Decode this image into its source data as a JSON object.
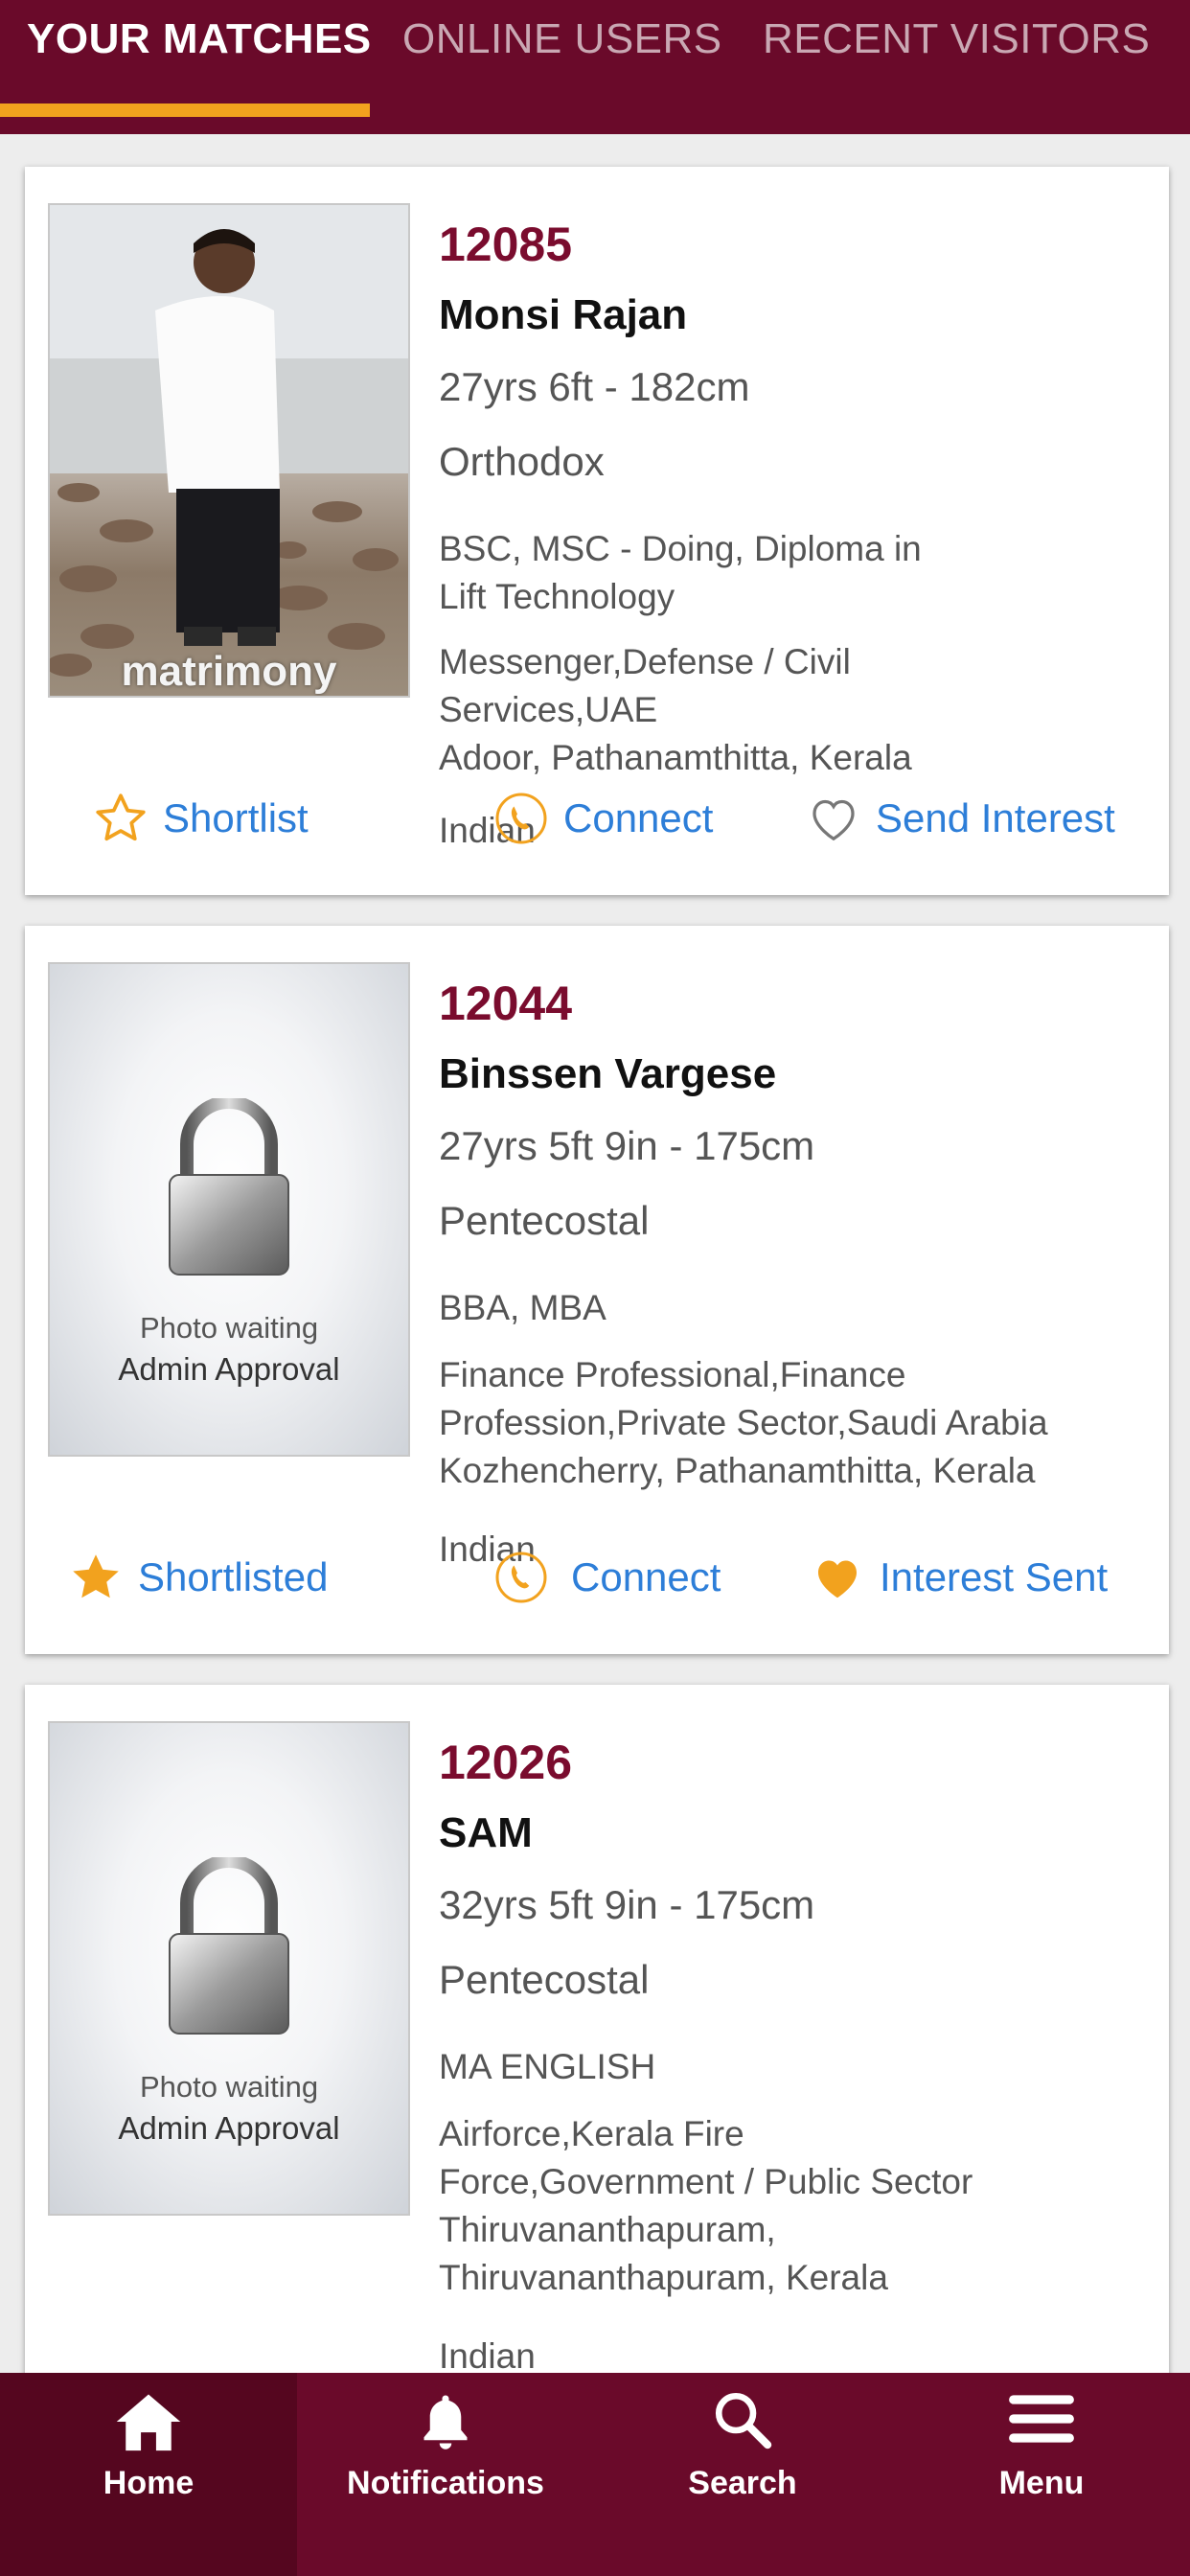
{
  "tabs": [
    {
      "label": "YOUR MATCHES",
      "active": true
    },
    {
      "label": "ONLINE USERS",
      "active": false
    },
    {
      "label": "RECENT VISITORS",
      "active": false
    }
  ],
  "photo_watermark": "matrimony",
  "locked_photo": {
    "line1": "Photo waiting",
    "line2": "Admin Approval"
  },
  "profiles": [
    {
      "id": "12085",
      "name": "Monsi Rajan",
      "age_height": "27yrs 6ft - 182cm",
      "denomination": "Orthodox",
      "education_1": "BSC, MSC - Doing, Diploma in",
      "education_2": "Lift Technology",
      "job_1": "Messenger,Defense / Civil",
      "job_2": "Services,UAE",
      "location": "Adoor, Pathanamthitta, Kerala",
      "nationality": "Indian",
      "shortlist_label": "Shortlist",
      "connect_label": "Connect",
      "interest_label": "Send Interest"
    },
    {
      "id": "12044",
      "name": "Binssen Vargese",
      "age_height": "27yrs 5ft 9in - 175cm",
      "denomination": "Pentecostal",
      "education_1": "BBA, MBA",
      "job_1": "Finance Professional,Finance",
      "job_2": "Profession,Private Sector,Saudi Arabia",
      "location": "Kozhencherry, Pathanamthitta, Kerala",
      "nationality": "Indian",
      "shortlist_label": "Shortlisted",
      "connect_label": "Connect",
      "interest_label": "Interest Sent"
    },
    {
      "id": "12026",
      "name": "SAM",
      "age_height": "32yrs 5ft 9in - 175cm",
      "denomination": "Pentecostal",
      "education_1": "MA ENGLISH",
      "job_1": "Airforce,Kerala Fire",
      "job_2": "Force,Government / Public Sector",
      "location_1": "Thiruvananthapuram,",
      "location_2": "Thiruvananthapuram, Kerala",
      "nationality": "Indian"
    }
  ],
  "bottom_nav": [
    {
      "label": "Home",
      "icon": "home-icon",
      "active": true
    },
    {
      "label": "Notifications",
      "icon": "bell-icon",
      "active": false
    },
    {
      "label": "Search",
      "icon": "search-icon",
      "active": false
    },
    {
      "label": "Menu",
      "icon": "menu-icon",
      "active": false
    }
  ],
  "colors": {
    "brand": "#6a0a2a",
    "accent": "#f2a21e",
    "link": "#2d7ed8",
    "profile_id": "#7a0c2e"
  }
}
